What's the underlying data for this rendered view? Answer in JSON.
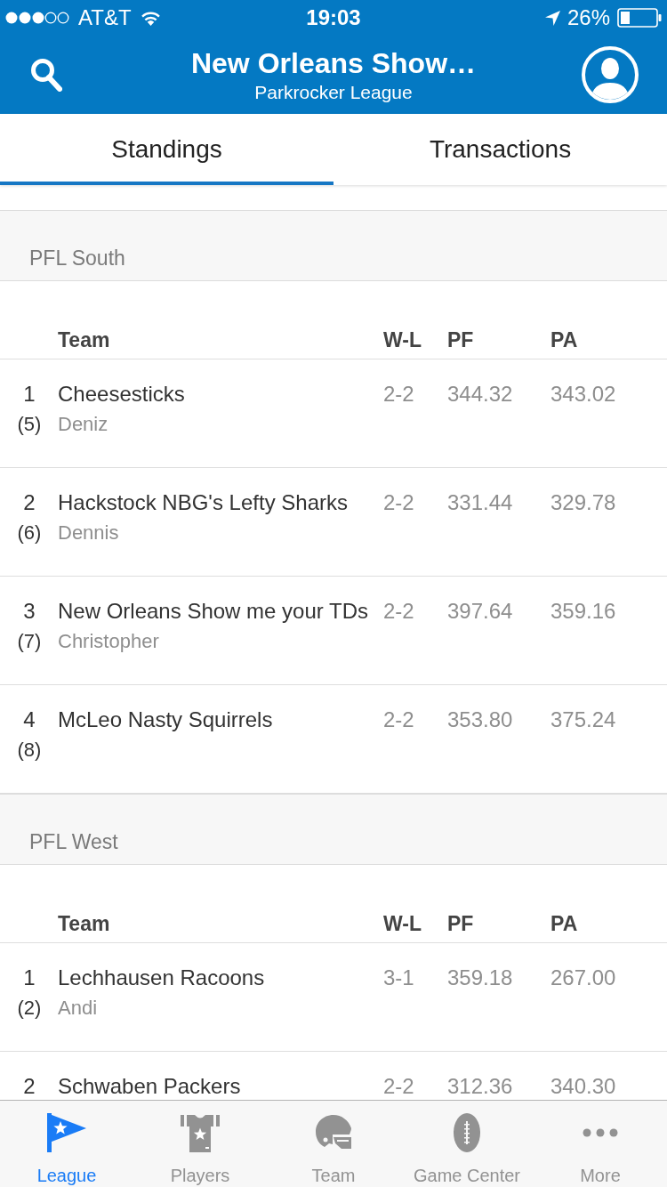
{
  "status_bar": {
    "carrier": "AT&T",
    "time": "19:03",
    "battery": "26%"
  },
  "header": {
    "title": "New Orleans Show…",
    "subtitle": "Parkrocker League"
  },
  "tabs": [
    {
      "label": "Standings",
      "selected": true
    },
    {
      "label": "Transactions",
      "selected": false
    }
  ],
  "divisions": [
    {
      "name": "PFL South",
      "columns": [
        "Team",
        "W-L",
        "PF",
        "PA"
      ],
      "rows": [
        {
          "rank": "1",
          "seed": "(5)",
          "team": "Cheesesticks",
          "owner": "Deniz",
          "wl": "2-2",
          "pf": "344.32",
          "pa": "343.02"
        },
        {
          "rank": "2",
          "seed": "(6)",
          "team": "Hackstock NBG's Lefty Sharks",
          "owner": "Dennis",
          "wl": "2-2",
          "pf": "331.44",
          "pa": "329.78"
        },
        {
          "rank": "3",
          "seed": "(7)",
          "team": "New Orleans Show me your TDs",
          "owner": "Christopher",
          "wl": "2-2",
          "pf": "397.64",
          "pa": "359.16"
        },
        {
          "rank": "4",
          "seed": "(8)",
          "team": "McLeo Nasty Squirrels",
          "wl": "2-2",
          "pf": "353.80",
          "pa": "375.24"
        }
      ]
    },
    {
      "name": "PFL West",
      "columns": [
        "Team",
        "W-L",
        "PF",
        "PA"
      ],
      "rows": [
        {
          "rank": "1",
          "seed": "(2)",
          "team": "Lechhausen Racoons",
          "owner": "Andi",
          "wl": "3-1",
          "pf": "359.18",
          "pa": "267.00"
        },
        {
          "rank": "2",
          "team": "Schwaben Packers",
          "wl": "2-2",
          "pf": "312.36",
          "pa": "340.30"
        }
      ]
    }
  ],
  "tab_bar": [
    {
      "kind": "flag",
      "label": "League",
      "selected": true
    },
    {
      "kind": "jersey",
      "label": "Players",
      "selected": false
    },
    {
      "kind": "helmet",
      "label": "Team",
      "selected": false
    },
    {
      "kind": "football",
      "label": "Game Center",
      "selected": false
    },
    {
      "kind": "more",
      "label": "More",
      "selected": false
    }
  ]
}
